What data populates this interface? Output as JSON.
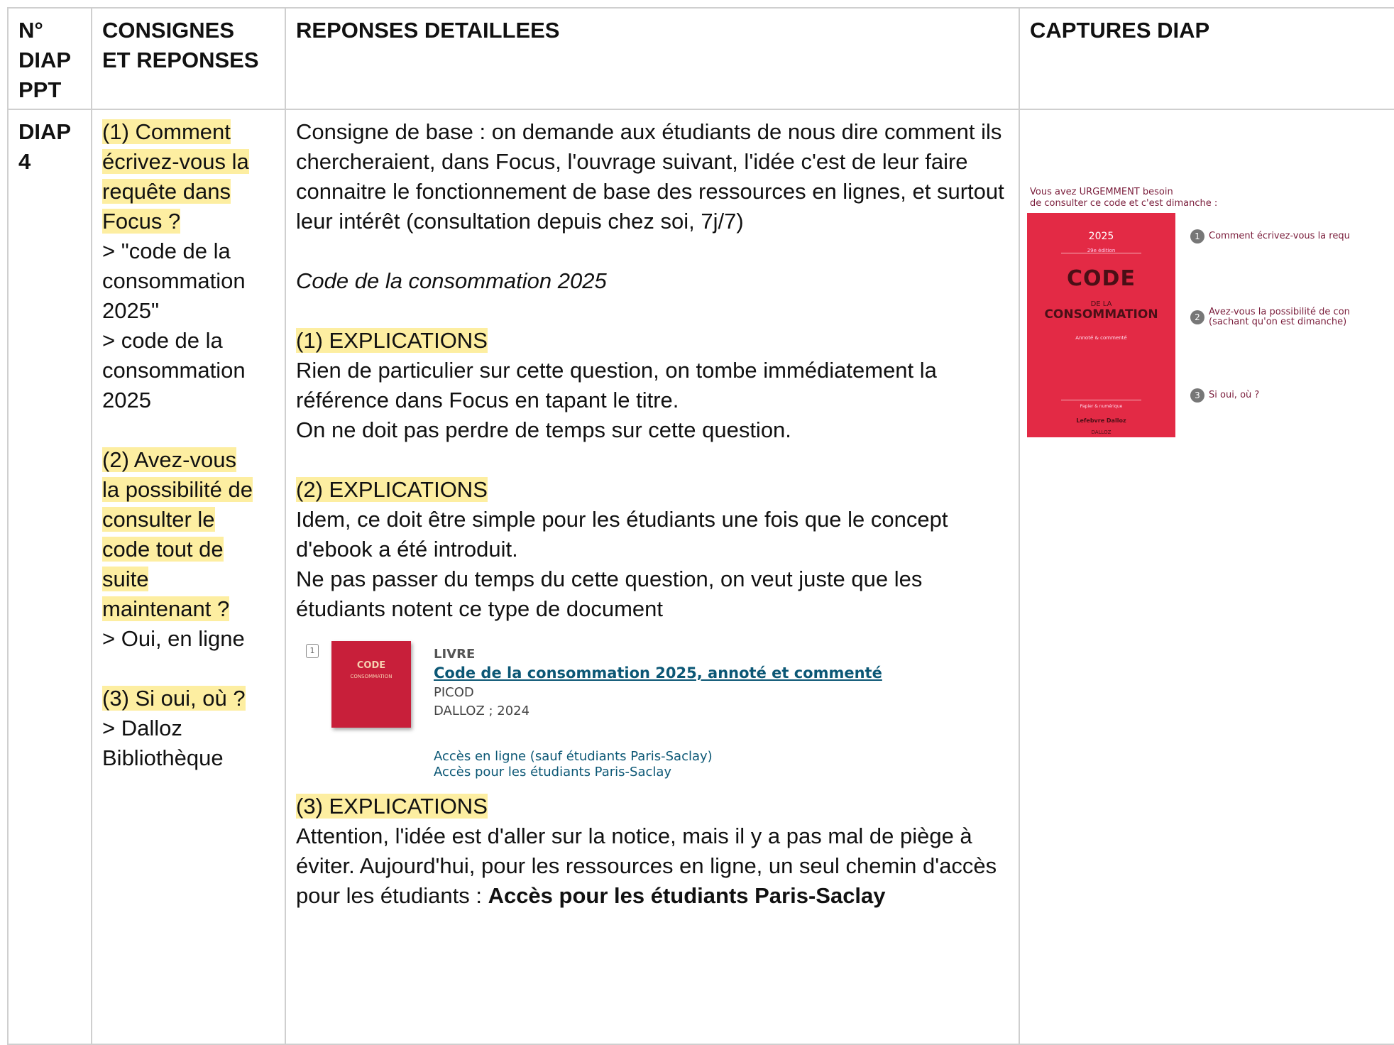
{
  "table": {
    "headers": {
      "col1": [
        "N°",
        "DIAP",
        "PPT"
      ],
      "col2": [
        "CONSIGNES",
        "ET REPONSES"
      ],
      "col3": "REPONSES DETAILLEES",
      "col4": "CAPTURES DIAP"
    },
    "row": {
      "slide_number": [
        "DIAP",
        "4"
      ],
      "consignes": {
        "q1_lines": [
          "(1) Comment",
          "écrivez-vous la",
          "requête dans",
          "Focus ?"
        ],
        "a1_lines": [
          "> \"code de la",
          "consommation",
          "2025\"",
          "> code de la",
          "consommation",
          "2025"
        ],
        "q2_lines": [
          "(2) Avez-vous",
          "la possibilité de",
          "consulter le",
          "code tout de",
          "suite",
          "maintenant ?"
        ],
        "a2_lines": [
          "> Oui, en ligne"
        ],
        "q3_lines": [
          "(3) Si oui, où ?"
        ],
        "a3_lines": [
          "> Dalloz",
          "Bibliothèque"
        ]
      },
      "details": {
        "intro": "Consigne de base : on demande aux étudiants de nous dire comment ils chercheraient, dans Focus, l'ouvrage suivant, l'idée c'est de leur faire connaitre le fonctionnement de base des ressources en lignes, et surtout leur intérêt (consultation depuis chez soi, 7j/7)",
        "book_title": "Code de la consommation 2025",
        "exp1_heading": "(1) EXPLICATIONS",
        "exp1_text": "Rien de particulier sur cette question, on tombe immédiatement la référence dans Focus en tapant le titre.",
        "exp1_text2": "On ne doit pas perdre de temps sur cette question.",
        "exp2_heading": "(2) EXPLICATIONS",
        "exp2_text": "Idem, ce doit être simple pour les étudiants une fois que le concept d'ebook a été introduit.",
        "exp2_text2": "Ne pas passer du temps du cette question, on veut juste que les étudiants notent ce type de document",
        "record": {
          "number": "1",
          "cover_title": "CODE",
          "cover_sub": "CONSOMMATION",
          "type": "LIVRE",
          "title": "Code de la consommation 2025, annoté et commenté",
          "author": "PICOD",
          "publisher": "DALLOZ ; 2024",
          "link1": "Accès en ligne (sauf étudiants Paris-Saclay)",
          "link2": "Accès pour les étudiants Paris-Saclay"
        },
        "exp3_heading": "(3) EXPLICATIONS",
        "exp3_text": "Attention, l'idée est d'aller sur la notice, mais il y a pas mal de piège à éviter. Aujourd'hui, pour les ressources en ligne, un seul chemin d'accès pour les étudiants : ",
        "exp3_bold": "Accès pour les étudiants Paris-Saclay"
      },
      "capture": {
        "intro_line1": "Vous avez URGEMMENT besoin",
        "intro_line2": "de consulter ce code et c'est dimanche :",
        "book": {
          "year": "2025",
          "edition": "29e édition",
          "title": "CODE",
          "de_la": "DE LA",
          "subtitle": "CONSOMMATION",
          "annote": "Annoté & commenté",
          "format": "Papier & numérique",
          "publisher": "Lefebvre Dalloz",
          "logo": "DALLOZ"
        },
        "questions": [
          {
            "num": "1",
            "lines": [
              "Comment écrivez-vous la requ"
            ]
          },
          {
            "num": "2",
            "lines": [
              "Avez-vous la possibilité de con",
              "(sachant qu'on est dimanche)"
            ]
          },
          {
            "num": "3",
            "lines": [
              "Si oui, où ?"
            ]
          }
        ],
        "colors": {
          "text": "#7a1d3b",
          "cover": "#e32a45"
        }
      }
    },
    "highlight_color": "#fdeea1"
  }
}
